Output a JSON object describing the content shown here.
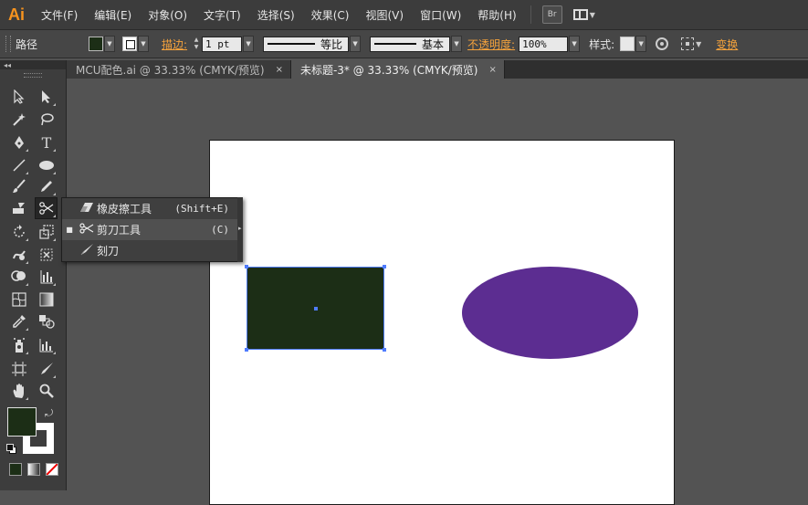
{
  "app": {
    "logo": "Ai"
  },
  "menubar": {
    "items": [
      "文件(F)",
      "编辑(E)",
      "对象(O)",
      "文字(T)",
      "选择(S)",
      "效果(C)",
      "视图(V)",
      "窗口(W)",
      "帮助(H)"
    ],
    "bridge_label": "Br"
  },
  "controlbar": {
    "selection_type": "路径",
    "fill_color": "#1c2e16",
    "stroke_link": "描边:",
    "stroke_weight": "1 pt",
    "stroke_profile_label": "等比",
    "brush_label": "基本",
    "opacity_link": "不透明度:",
    "opacity_value": "100%",
    "style_label": "样式:",
    "transform_link": "变换"
  },
  "tabs": [
    {
      "label": "MCU配色.ai @ 33.33% (CMYK/预览)",
      "close": "×"
    },
    {
      "label": "未标题-3* @ 33.33% (CMYK/预览)",
      "close": "×"
    }
  ],
  "toolpanel": {
    "collapse": "◂◂"
  },
  "flyout": {
    "items": [
      {
        "name": "橡皮擦工具",
        "shortcut": "(Shift+E)",
        "icon": "eraser-icon"
      },
      {
        "name": "剪刀工具",
        "shortcut": "(C)",
        "icon": "scissors-icon"
      },
      {
        "name": "刻刀",
        "shortcut": "",
        "icon": "knife-icon"
      }
    ]
  },
  "canvas": {
    "rectangle_color": "#1c2e16",
    "ellipse_color": "#5c2d91",
    "selection_color": "#4f7cff"
  }
}
